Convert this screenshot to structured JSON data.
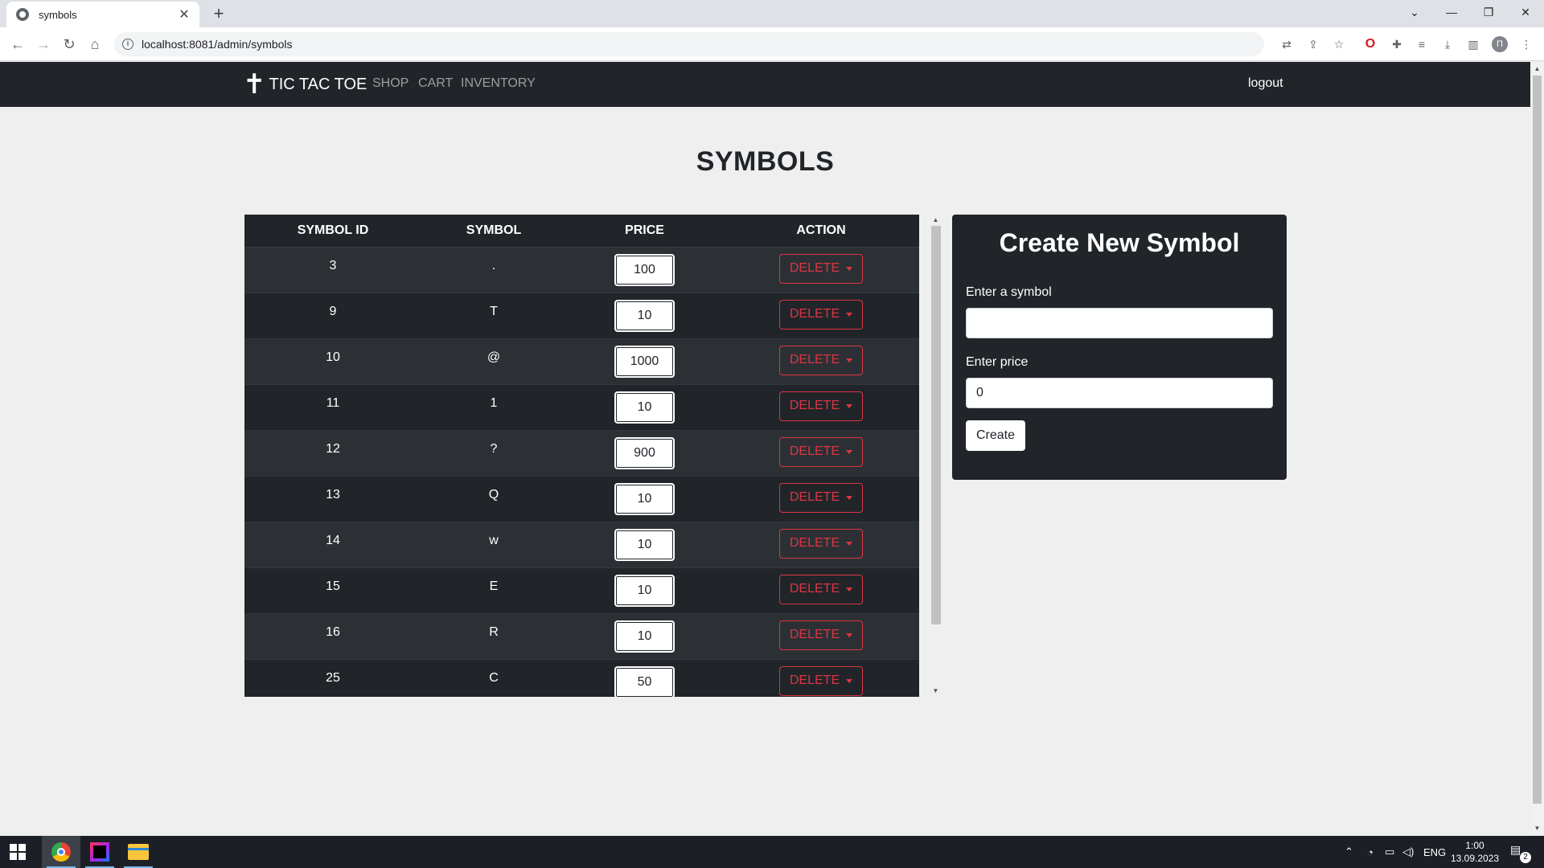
{
  "browser": {
    "tab_title": "symbols",
    "tab_close": "✕",
    "new_tab": "+",
    "url": "localhost:8081/admin/symbols",
    "icons": [
      "back-icon",
      "forward-icon",
      "reload-icon",
      "home-icon",
      "info-icon",
      "translate-icon",
      "share-icon",
      "bookmark-star-icon",
      "opera-icon",
      "extensions-icon",
      "media-icon",
      "download-icon",
      "sidepanel-icon",
      "profile-icon",
      "menu-icon"
    ],
    "profile_letter": "П"
  },
  "navbar": {
    "brand_glyph": "✝",
    "brand": "TIC TAC TOE",
    "links": [
      "SHOP",
      "CART",
      "INVENTORY"
    ],
    "logout": "logout"
  },
  "page": {
    "title": "SYMBOLS"
  },
  "table": {
    "headers": [
      "SYMBOL ID",
      "SYMBOL",
      "PRICE",
      "ACTION"
    ],
    "rows": [
      {
        "id": "3",
        "symbol": ".",
        "price": "100"
      },
      {
        "id": "9",
        "symbol": "T",
        "price": "10"
      },
      {
        "id": "10",
        "symbol": "@",
        "price": "1000"
      },
      {
        "id": "11",
        "symbol": "1",
        "price": "10"
      },
      {
        "id": "12",
        "symbol": "?",
        "price": "900"
      },
      {
        "id": "13",
        "symbol": "Q",
        "price": "10"
      },
      {
        "id": "14",
        "symbol": "w",
        "price": "10"
      },
      {
        "id": "15",
        "symbol": "E",
        "price": "10"
      },
      {
        "id": "16",
        "symbol": "R",
        "price": "10"
      },
      {
        "id": "25",
        "symbol": "C",
        "price": "50"
      }
    ],
    "action_label": "DELETE"
  },
  "form": {
    "title": "Create New Symbol",
    "symbol_label": "Enter a symbol",
    "symbol_value": "",
    "price_label": "Enter price",
    "price_value": "0",
    "submit_label": "Create"
  },
  "taskbar": {
    "apps": [
      "chrome",
      "intellij-idea",
      "file-explorer"
    ],
    "language": "ENG",
    "time": "1:00",
    "date": "13.09.2023",
    "notifications": "2"
  },
  "colors": {
    "navbar_bg": "#212529",
    "danger": "#dc3545",
    "page_bg": "#efefef"
  }
}
